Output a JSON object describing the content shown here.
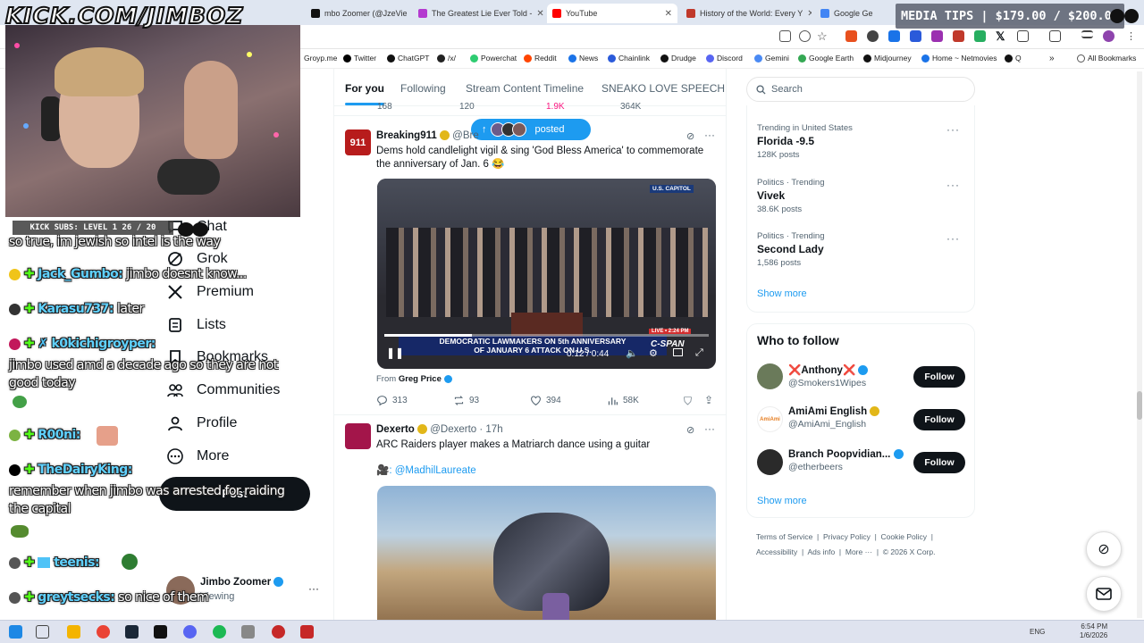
{
  "browser": {
    "tabs": [
      {
        "title": "mbo Zoomer (@JzeVie",
        "color": "#111"
      },
      {
        "title": "The Greatest Lie Ever Told - ",
        "color": "#b43ad0"
      },
      {
        "title": "YouTube",
        "color": "#ff0000"
      },
      {
        "title": "History of the World: Every Y",
        "color": "#c0392b"
      },
      {
        "title": "Google Ge",
        "color": "#4285f4"
      }
    ],
    "bookmarks": [
      {
        "label": "Groyp.me",
        "color": "#888"
      },
      {
        "label": "Twitter",
        "color": "#000"
      },
      {
        "label": "ChatGPT",
        "color": "#111"
      },
      {
        "label": "/x/",
        "color": "#222"
      },
      {
        "label": "Powerchat",
        "color": "#2ecc71"
      },
      {
        "label": "Reddit",
        "color": "#ff4500"
      },
      {
        "label": "News",
        "color": "#1a73e8"
      },
      {
        "label": "Chainlink",
        "color": "#2a5ada"
      },
      {
        "label": "Drudge",
        "color": "#111"
      },
      {
        "label": "Discord",
        "color": "#5865f2"
      },
      {
        "label": "Gemini",
        "color": "#4a8af4"
      },
      {
        "label": "Google Earth",
        "color": "#34a853"
      },
      {
        "label": "Midjourney",
        "color": "#111"
      },
      {
        "label": "Home ~ Netmovies",
        "color": "#1a73e8"
      },
      {
        "label": "Q",
        "color": "#111"
      }
    ],
    "all_bookmarks": "All Bookmarks"
  },
  "overlay": {
    "logo": "KICK.COM/JIMBOZ",
    "media_tips": "MEDIA TIPS | $179.00 / $200.00",
    "subs": "KICK SUBS: LEVEL 1 26 / 20",
    "chat": [
      {
        "name": "",
        "message": "so true, im jewish so intel is the way",
        "badge": ""
      },
      {
        "name": "Jack_Gumbo:",
        "message": "jimbo doesnt know...",
        "badge": "#f0c419"
      },
      {
        "name": "Karasu737:",
        "message": "later",
        "badge": "#333"
      },
      {
        "name": "k0kichigroyper:",
        "message": "",
        "badge": "#c2185b"
      },
      {
        "name": "",
        "message": "jimbo used amd a decade ago so they are not",
        "badge": ""
      },
      {
        "name": "",
        "message": "good today",
        "badge": ""
      },
      {
        "name": "R00ni:",
        "message": "",
        "badge": "#7cb342"
      },
      {
        "name": "TheDairyKing:",
        "message": "",
        "badge": "#000"
      },
      {
        "name": "",
        "message": "remember when jimbo was arrested for raiding",
        "badge": ""
      },
      {
        "name": "",
        "message": "the capital",
        "badge": ""
      },
      {
        "name": "teenis:",
        "message": "",
        "badge": "#555"
      },
      {
        "name": "greytsecks:",
        "message": "so nice of them",
        "badge": "#555"
      }
    ]
  },
  "nav": {
    "items": [
      {
        "label": "Chat",
        "icon": "chat-icon"
      },
      {
        "label": "Grok",
        "icon": "grok-icon"
      },
      {
        "label": "Premium",
        "icon": "x-logo-icon"
      },
      {
        "label": "Lists",
        "icon": "lists-icon"
      },
      {
        "label": "Bookmarks",
        "icon": "bookmark-icon"
      },
      {
        "label": "Communities",
        "icon": "communities-icon"
      },
      {
        "label": "Profile",
        "icon": "profile-icon"
      },
      {
        "label": "More",
        "icon": "more-icon"
      }
    ],
    "post_label": "Post",
    "account": {
      "name": "Jimbo Zoomer",
      "sub": "Viewing"
    }
  },
  "feed": {
    "tabs": [
      {
        "label": "For you",
        "active": true
      },
      {
        "label": "Following",
        "active": false
      },
      {
        "label": "Stream Content Timeline",
        "active": false
      },
      {
        "label": "SNEAKO LOVE SPEECH",
        "active": false
      }
    ],
    "posted_pill": "posted",
    "prev_stats": [
      "168",
      "120",
      "1.9K",
      "364K"
    ],
    "tweets": [
      {
        "author": "Breaking911",
        "handle": "@Bre",
        "time": "",
        "avatar_label": "911",
        "text": "Dems hold candlelight vigil & sing 'God Bless America' to commemorate the anniversary of Jan. 6 😂",
        "media": {
          "corner": "U.S. CAPITOL",
          "caption_line1": "DEMOCRATIC LAWMAKERS ON 5th ANNIVERSARY",
          "caption_line2": "OF JANUARY 6 ATTACK ON U.S.",
          "network": "C-SPAN",
          "live": "LIVE • 2:24 PM",
          "time": "0:12 / 0:44",
          "progress": 0.27
        },
        "from_label": "From",
        "from_name": "Greg Price",
        "stats": {
          "replies": "313",
          "reposts": "93",
          "likes": "394",
          "views": "58K"
        }
      },
      {
        "author": "Dexerto",
        "handle": "@Dexerto",
        "time": "· 17h",
        "text": "ARC Raiders player makes a Matriarch dance using a guitar",
        "credit": "🎥: @MadhilLaureate"
      }
    ]
  },
  "sidebar": {
    "search_placeholder": "Search",
    "trends": [
      {
        "meta": "Trending in United States",
        "name": "Florida -9.5",
        "posts": "128K posts"
      },
      {
        "meta": "Politics · Trending",
        "name": "Vivek",
        "posts": "38.6K posts"
      },
      {
        "meta": "Politics · Trending",
        "name": "Second Lady",
        "posts": "1,586 posts"
      }
    ],
    "trend_show_more": "Show more",
    "who_to_follow_title": "Who to follow",
    "who_to_follow": [
      {
        "name": "❌Anthony❌",
        "handle": "@Smokers1Wipes",
        "button": "Follow",
        "verified": "blue"
      },
      {
        "name": "AmiAmi English",
        "handle": "@AmiAmi_English",
        "button": "Follow",
        "verified": "gold"
      },
      {
        "name": "Branch Poopvidian...",
        "handle": "@etherbeers",
        "button": "Follow",
        "verified": "blue"
      }
    ],
    "follow_show_more": "Show more",
    "footer_row1": [
      "Terms of Service",
      "Privacy Policy",
      "Cookie Policy"
    ],
    "footer_row2": [
      "Accessibility",
      "Ads info",
      "More ···",
      "© 2026 X Corp."
    ]
  },
  "taskbar": {
    "lang": "ENG",
    "time": "6:54 PM",
    "date": "1/6/2026"
  }
}
